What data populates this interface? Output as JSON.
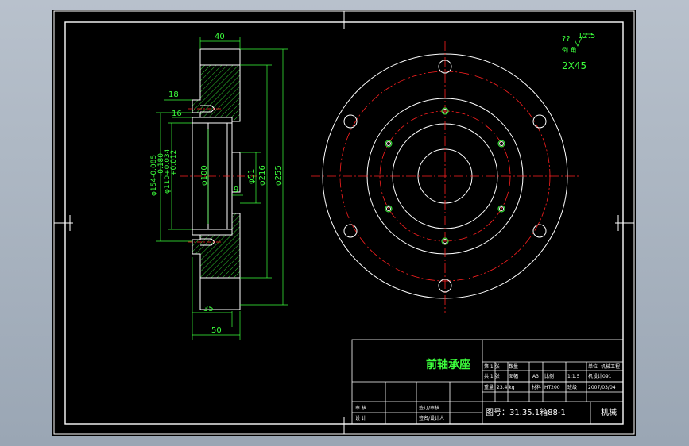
{
  "colors": {
    "background": "#000000",
    "outline": "#ffffff",
    "dimension": "#3cff3c",
    "centerline": "#ff2020",
    "hatch": "#3cff3c"
  },
  "dimensions": {
    "top_width": "40",
    "small_a": "18",
    "small_b": "16",
    "d_outer_tol": "φ154-0.085",
    "d_outer_tol2": "-0.180",
    "d_inner_tol": "φ110+0.034",
    "d_inner_tol2": "+0.012",
    "d100": "φ100",
    "d51": "φ51",
    "d216": "φ216",
    "d255": "φ255",
    "gap": "9",
    "bottom_35": "35",
    "bottom_50": "50"
  },
  "notes": {
    "roughness_prefix": "??",
    "roughness_value": "12.5",
    "chamfer_label": "倒 角",
    "chamfer_value": "2X45"
  },
  "title_block": {
    "part_name": "前轴承座",
    "sheet_a": "第 1 张",
    "sheet_b": "共 1 张",
    "count_label": "数量",
    "scale_label": "比例",
    "scale_value": "1:1.5",
    "paper_label": "图幅",
    "paper_value": "A3",
    "weight_label": "重量",
    "weight_value": "23.4 kg",
    "material_label": "材料",
    "material_value": "HT200",
    "unit_label": "单位",
    "unit_value": "机械工程",
    "class_label": "班级",
    "class_value": "机设计091",
    "date_value": "2007/03/04",
    "review": "审 核",
    "design": "设 计",
    "reviewer": "签订/审核",
    "designer": "签名/设计人",
    "drawing_no": "图号：31.35.1箱88-1",
    "stamp": "机械"
  }
}
